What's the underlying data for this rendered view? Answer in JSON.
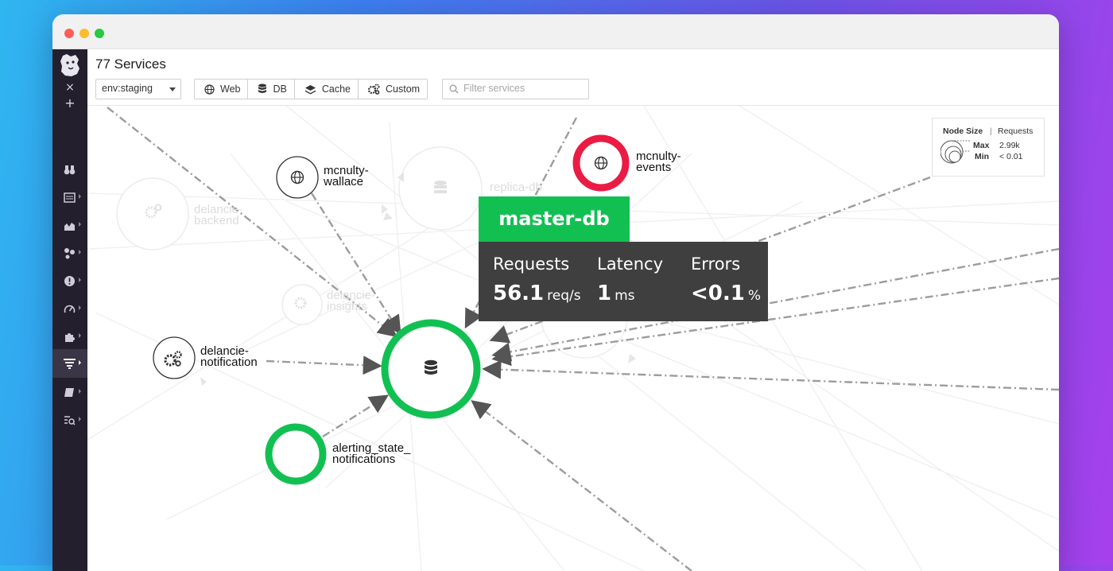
{
  "window": {
    "traffic_lights": [
      "close",
      "minimize",
      "zoom"
    ]
  },
  "sidebar": {
    "close_glyph": "×",
    "add_glyph": "+",
    "items": [
      {
        "icon": "binoculars-icon"
      },
      {
        "icon": "dashboard-list-icon"
      },
      {
        "icon": "metrics-chart-icon"
      },
      {
        "icon": "integrations-hexagon-icon"
      },
      {
        "icon": "alert-exclamation-icon"
      },
      {
        "icon": "gauge-icon"
      },
      {
        "icon": "puzzle-icon"
      },
      {
        "icon": "apm-filter-icon",
        "active": true
      },
      {
        "icon": "notebook-icon"
      },
      {
        "icon": "logs-search-icon"
      }
    ]
  },
  "header": {
    "title": "77 Services",
    "env_select": {
      "value": "env:staging"
    },
    "type_filters": [
      {
        "label": "Web",
        "icon": "globe-icon"
      },
      {
        "label": "DB",
        "icon": "database-icon"
      },
      {
        "label": "Cache",
        "icon": "layers-icon"
      },
      {
        "label": "Custom",
        "icon": "gears-icon"
      }
    ],
    "search": {
      "placeholder": "Filter services",
      "value": ""
    }
  },
  "legend": {
    "title": "Node Size",
    "separator": "|",
    "metric": "Requests",
    "max_label": "Max",
    "max_value": "2.99k",
    "min_label": "Min",
    "min_value": "< 0.01"
  },
  "nodes": {
    "mcnulty_wallace": "mcnulty-\nwallace",
    "mcnulty_events": "mcnulty-\nevents",
    "delancie_notification": "delancie-\nnotification",
    "alerting_state_notifications": "alerting_state_\nnotifications",
    "delancie_backend": "delancie-\nbackend",
    "delancie_insights": "delancie-\ninsights",
    "replica_db": "replica-db"
  },
  "tooltip": {
    "service": "master-db",
    "metrics": [
      {
        "label": "Requests",
        "value": "56.1",
        "unit": "req/s"
      },
      {
        "label": "Latency",
        "value": "1",
        "unit": "ms"
      },
      {
        "label": "Errors",
        "value": "<0.1",
        "unit": "%"
      }
    ]
  },
  "colors": {
    "healthy": "#12c052",
    "error": "#ea1c44",
    "sidebar_bg": "#231f2c",
    "tooltip_bg": "#3f3f3f"
  }
}
